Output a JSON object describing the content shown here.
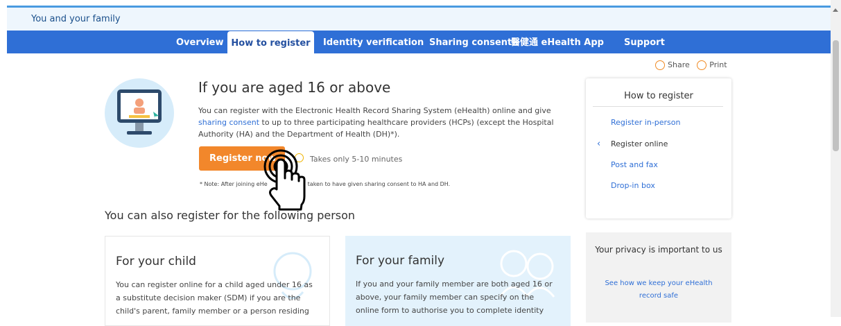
{
  "header": {
    "title": "You and your family"
  },
  "nav": {
    "tabs": [
      {
        "label": "Overview"
      },
      {
        "label": "How to register"
      },
      {
        "label": "Identity verification"
      },
      {
        "label": "Sharing consent"
      },
      {
        "label": "醫健通 eHealth App"
      },
      {
        "label": "Support"
      }
    ]
  },
  "tools": {
    "share": "Share",
    "print": "Print"
  },
  "main": {
    "title": "If you are aged 16 or above",
    "intro_1": "You can register with the Electronic Health Record Sharing System (eHealth) online and give",
    "intro_link": "sharing consent",
    "intro_2": "to up to three participating healthcare providers (HCPs) (except the Hospital Authority (HA) and the Department of Health (DH)*).",
    "register_button": "Register now",
    "time_note": "Takes only 5-10 minutes",
    "note_1": "* Note: After joining eHe",
    "note_2": "taken to have given sharing consent to HA and DH.",
    "also_heading": "You can also register for the following person"
  },
  "sidebar": {
    "title": "How to register",
    "items": [
      {
        "label": "Register in-person"
      },
      {
        "label": "Register online"
      },
      {
        "label": "Post and fax"
      },
      {
        "label": "Drop-in box"
      }
    ]
  },
  "cards": [
    {
      "title": "For your child",
      "text": "You can register online for a child aged under 16 as a substitute decision maker (SDM) if you are the child's parent, family member or a person residing"
    },
    {
      "title": "For your family",
      "text": "If you and your family member are both aged 16 or above, your family member can specify on the online form to authorise you to complete identity"
    }
  ],
  "privacy": {
    "title": "Your privacy is important to us",
    "link": "See how we keep your eHealth record safe"
  },
  "colors": {
    "nav_blue": "#2f6fd6",
    "orange": "#f2872b",
    "light_blue": "#e3f2fc"
  }
}
